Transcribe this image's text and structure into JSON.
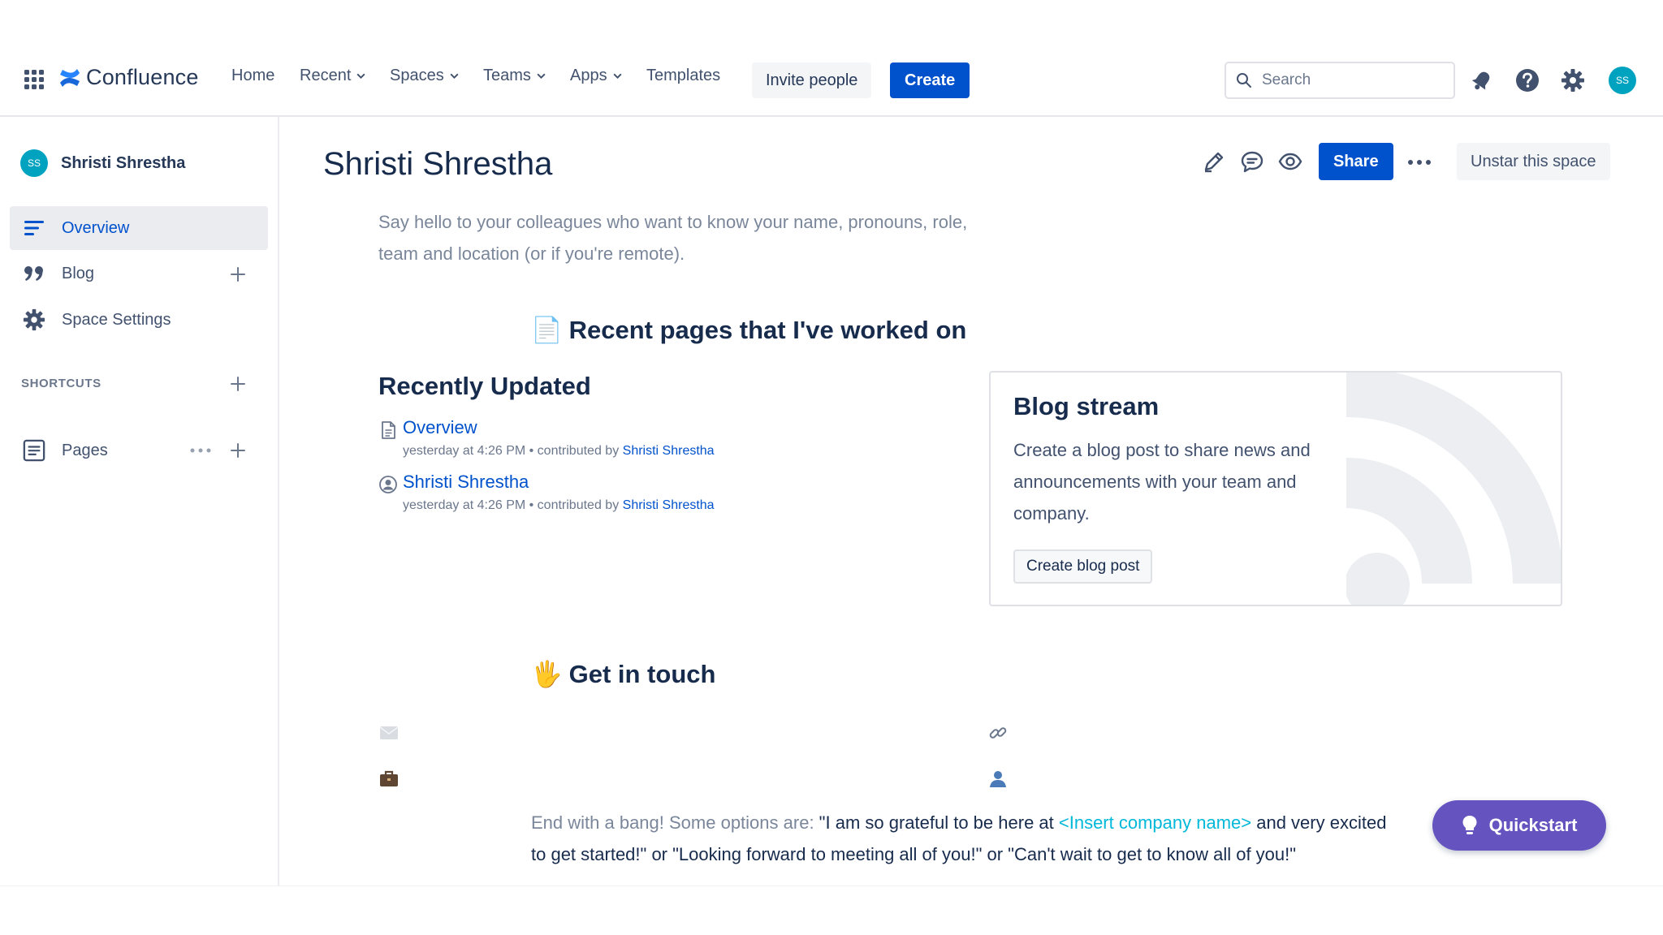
{
  "topnav": {
    "app_name": "Confluence",
    "items": [
      {
        "label": "Home",
        "has_dropdown": false
      },
      {
        "label": "Recent",
        "has_dropdown": true
      },
      {
        "label": "Spaces",
        "has_dropdown": true
      },
      {
        "label": "Teams",
        "has_dropdown": true
      },
      {
        "label": "Apps",
        "has_dropdown": true
      },
      {
        "label": "Templates",
        "has_dropdown": false
      }
    ],
    "invite_label": "Invite people",
    "create_label": "Create",
    "search_placeholder": "Search",
    "avatar_initials": "SS",
    "icons": [
      "app-switcher-icon",
      "notifications-icon",
      "help-icon",
      "settings-icon"
    ]
  },
  "sidebar": {
    "space_name": "Shristi Shrestha",
    "space_initials": "SS",
    "items": [
      {
        "label": "Overview",
        "icon": "overview-icon",
        "active": true
      },
      {
        "label": "Blog",
        "icon": "quote-icon",
        "active": false
      },
      {
        "label": "Space Settings",
        "icon": "gear-icon",
        "active": false
      }
    ],
    "shortcuts_label": "SHORTCUTS",
    "pages_label": "Pages"
  },
  "page": {
    "title": "Shristi Shrestha",
    "share_label": "Share",
    "unstar_label": "Unstar this space",
    "intro": "Say hello to your colleagues who want to know your name, pronouns, role, team and location (or if you're remote).",
    "recent_heading": "Recent pages that I've worked on",
    "recent_emoji": "📄",
    "recently_updated_title": "Recently Updated",
    "recent_items": [
      {
        "title": "Overview",
        "meta": "yesterday at 4:26 PM • contributed by",
        "contributor": "Shristi Shrestha",
        "icon": "page-icon"
      },
      {
        "title": "Shristi Shrestha",
        "meta": "yesterday at 4:26 PM • contributed by",
        "contributor": "Shristi Shrestha",
        "icon": "user-circle-icon"
      }
    ],
    "blog_stream": {
      "title": "Blog stream",
      "text": "Create a blog post to share news and announcements with your team and company.",
      "button": "Create blog post"
    },
    "touch_heading": "Get in touch",
    "touch_emoji": "🖐",
    "contact_icons": [
      "envelope-icon",
      "link-icon",
      "briefcase-icon",
      "person-icon"
    ],
    "ending": {
      "prefix": "End with a bang! Some options are:",
      "part1": " \"I am so grateful to be here at ",
      "company": "<Insert company name>",
      "part2": " and very excited to get started!\" or \"Looking forward to meeting all of you!\" or \"Can't wait to get to know all of you!\""
    }
  },
  "quickstart_label": "Quickstart",
  "colors": {
    "brand_blue": "#0052cc",
    "quickstart_purple": "#6554c0",
    "avatar_teal": "#00a3bf",
    "placeholder_teal": "#00b8d9"
  }
}
